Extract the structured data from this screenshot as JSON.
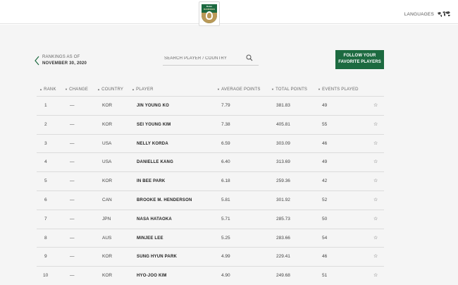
{
  "header": {
    "logo": {
      "line1": "Rolex",
      "line2": "RANKINGS",
      "icon": "rolex-rankings-crest-icon"
    },
    "languages_label": "LANGUAGES",
    "languages_icon": "world-map-icon"
  },
  "rankings_as_of": {
    "label": "RANKINGS AS OF",
    "date": "NOVEMBER 30, 2020",
    "back_icon": "chevron-left-icon"
  },
  "search": {
    "placeholder": "SEARCH PLAYER / COUNTRY",
    "value": "",
    "icon": "search-icon"
  },
  "follow_button": {
    "line1": "FOLLOW YOUR",
    "line2": "FAVORITE PLAYERS"
  },
  "columns": [
    {
      "key": "rank",
      "label": "RANK",
      "sort": "▲"
    },
    {
      "key": "change",
      "label": "CHANGE",
      "sort": "▼"
    },
    {
      "key": "country",
      "label": "COUNTRY",
      "sort": "▲"
    },
    {
      "key": "player",
      "label": "PLAYER",
      "sort": "▲"
    },
    {
      "key": "avg",
      "label": "AVERAGE POINTS",
      "sort": "▼"
    },
    {
      "key": "total",
      "label": "TOTAL POINTS",
      "sort": "▼"
    },
    {
      "key": "events",
      "label": "EVENTS PLAYED",
      "sort": "▼"
    }
  ],
  "rows": [
    {
      "rank": "1",
      "change": "—",
      "country": "KOR",
      "player": "JIN YOUNG KO",
      "avg": "7.79",
      "total": "381.83",
      "events": "49"
    },
    {
      "rank": "2",
      "change": "—",
      "country": "KOR",
      "player": "SEI YOUNG KIM",
      "avg": "7.38",
      "total": "405.81",
      "events": "55"
    },
    {
      "rank": "3",
      "change": "—",
      "country": "USA",
      "player": "NELLY KORDA",
      "avg": "6.59",
      "total": "303.09",
      "events": "46"
    },
    {
      "rank": "4",
      "change": "—",
      "country": "USA",
      "player": "DANIELLE KANG",
      "avg": "6.40",
      "total": "313.69",
      "events": "49"
    },
    {
      "rank": "5",
      "change": "—",
      "country": "KOR",
      "player": "IN BEE PARK",
      "avg": "6.18",
      "total": "259.36",
      "events": "42"
    },
    {
      "rank": "6",
      "change": "—",
      "country": "CAN",
      "player": "BROOKE M. HENDERSON",
      "avg": "5.81",
      "total": "301.92",
      "events": "52"
    },
    {
      "rank": "7",
      "change": "—",
      "country": "JPN",
      "player": "NASA HATAOKA",
      "avg": "5.71",
      "total": "285.73",
      "events": "50"
    },
    {
      "rank": "8",
      "change": "—",
      "country": "AUS",
      "player": "MINJEE LEE",
      "avg": "5.25",
      "total": "283.66",
      "events": "54"
    },
    {
      "rank": "9",
      "change": "—",
      "country": "KOR",
      "player": "SUNG HYUN PARK",
      "avg": "4.99",
      "total": "229.41",
      "events": "46"
    },
    {
      "rank": "10",
      "change": "—",
      "country": "KOR",
      "player": "HYO-JOO KIM",
      "avg": "4.90",
      "total": "249.68",
      "events": "51"
    }
  ],
  "favorite_icon": "star-outline-icon",
  "favorite_glyph": "☆",
  "colors": {
    "brand_green": "#1c6a40",
    "gold": "#b99958",
    "background": "#f5f5f5"
  }
}
